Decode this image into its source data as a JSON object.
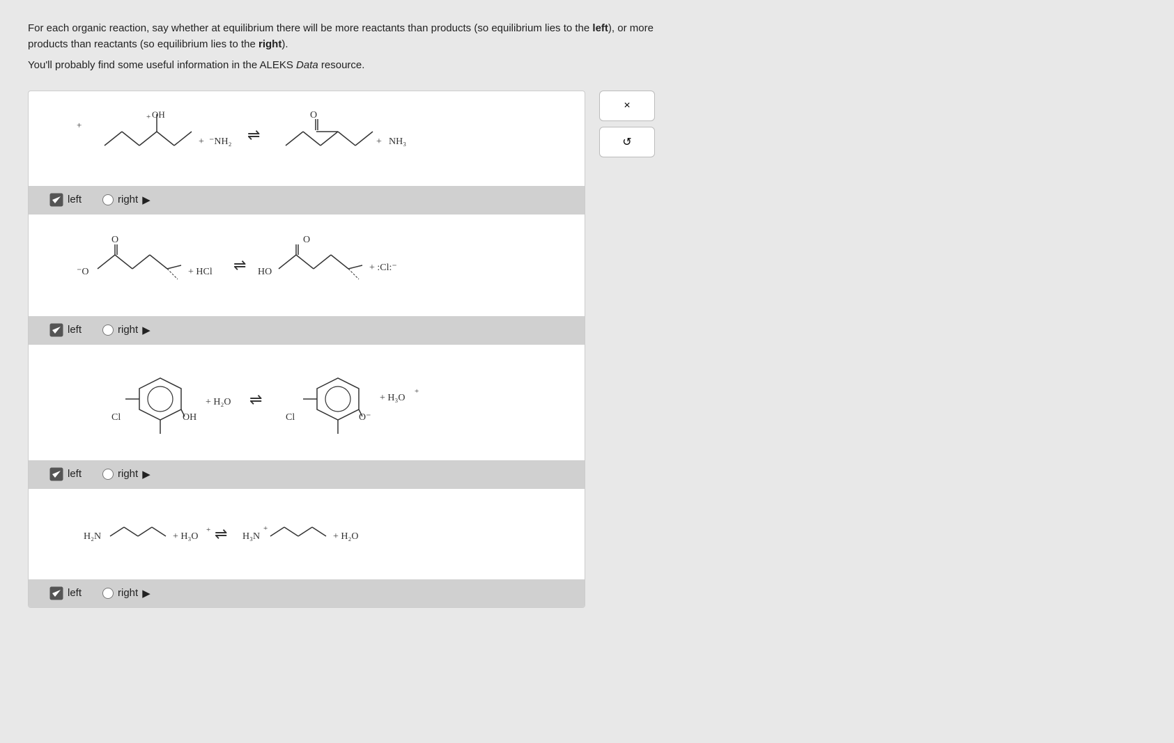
{
  "instructions": {
    "line1": "For each organic reaction, say whether at equilibrium there will be more reactants than products (so equilibrium lies to the ",
    "bold1": "left",
    "line1b": "), or more products than",
    "line2": "reactants (so equilibrium lies to the ",
    "bold2": "right",
    "line2b": ").",
    "line3": "You'll probably find some useful information in the ALEKS ",
    "italic1": "Data",
    "line3b": " resource."
  },
  "reactions": [
    {
      "id": 1,
      "answer": "left",
      "left_label": "left",
      "right_label": "right"
    },
    {
      "id": 2,
      "answer": "left",
      "left_label": "left",
      "right_label": "right"
    },
    {
      "id": 3,
      "answer": "left",
      "left_label": "left",
      "right_label": "right"
    },
    {
      "id": 4,
      "answer": "left",
      "left_label": "left",
      "right_label": "right"
    }
  ],
  "buttons": {
    "close": "×",
    "reset": "↺"
  }
}
